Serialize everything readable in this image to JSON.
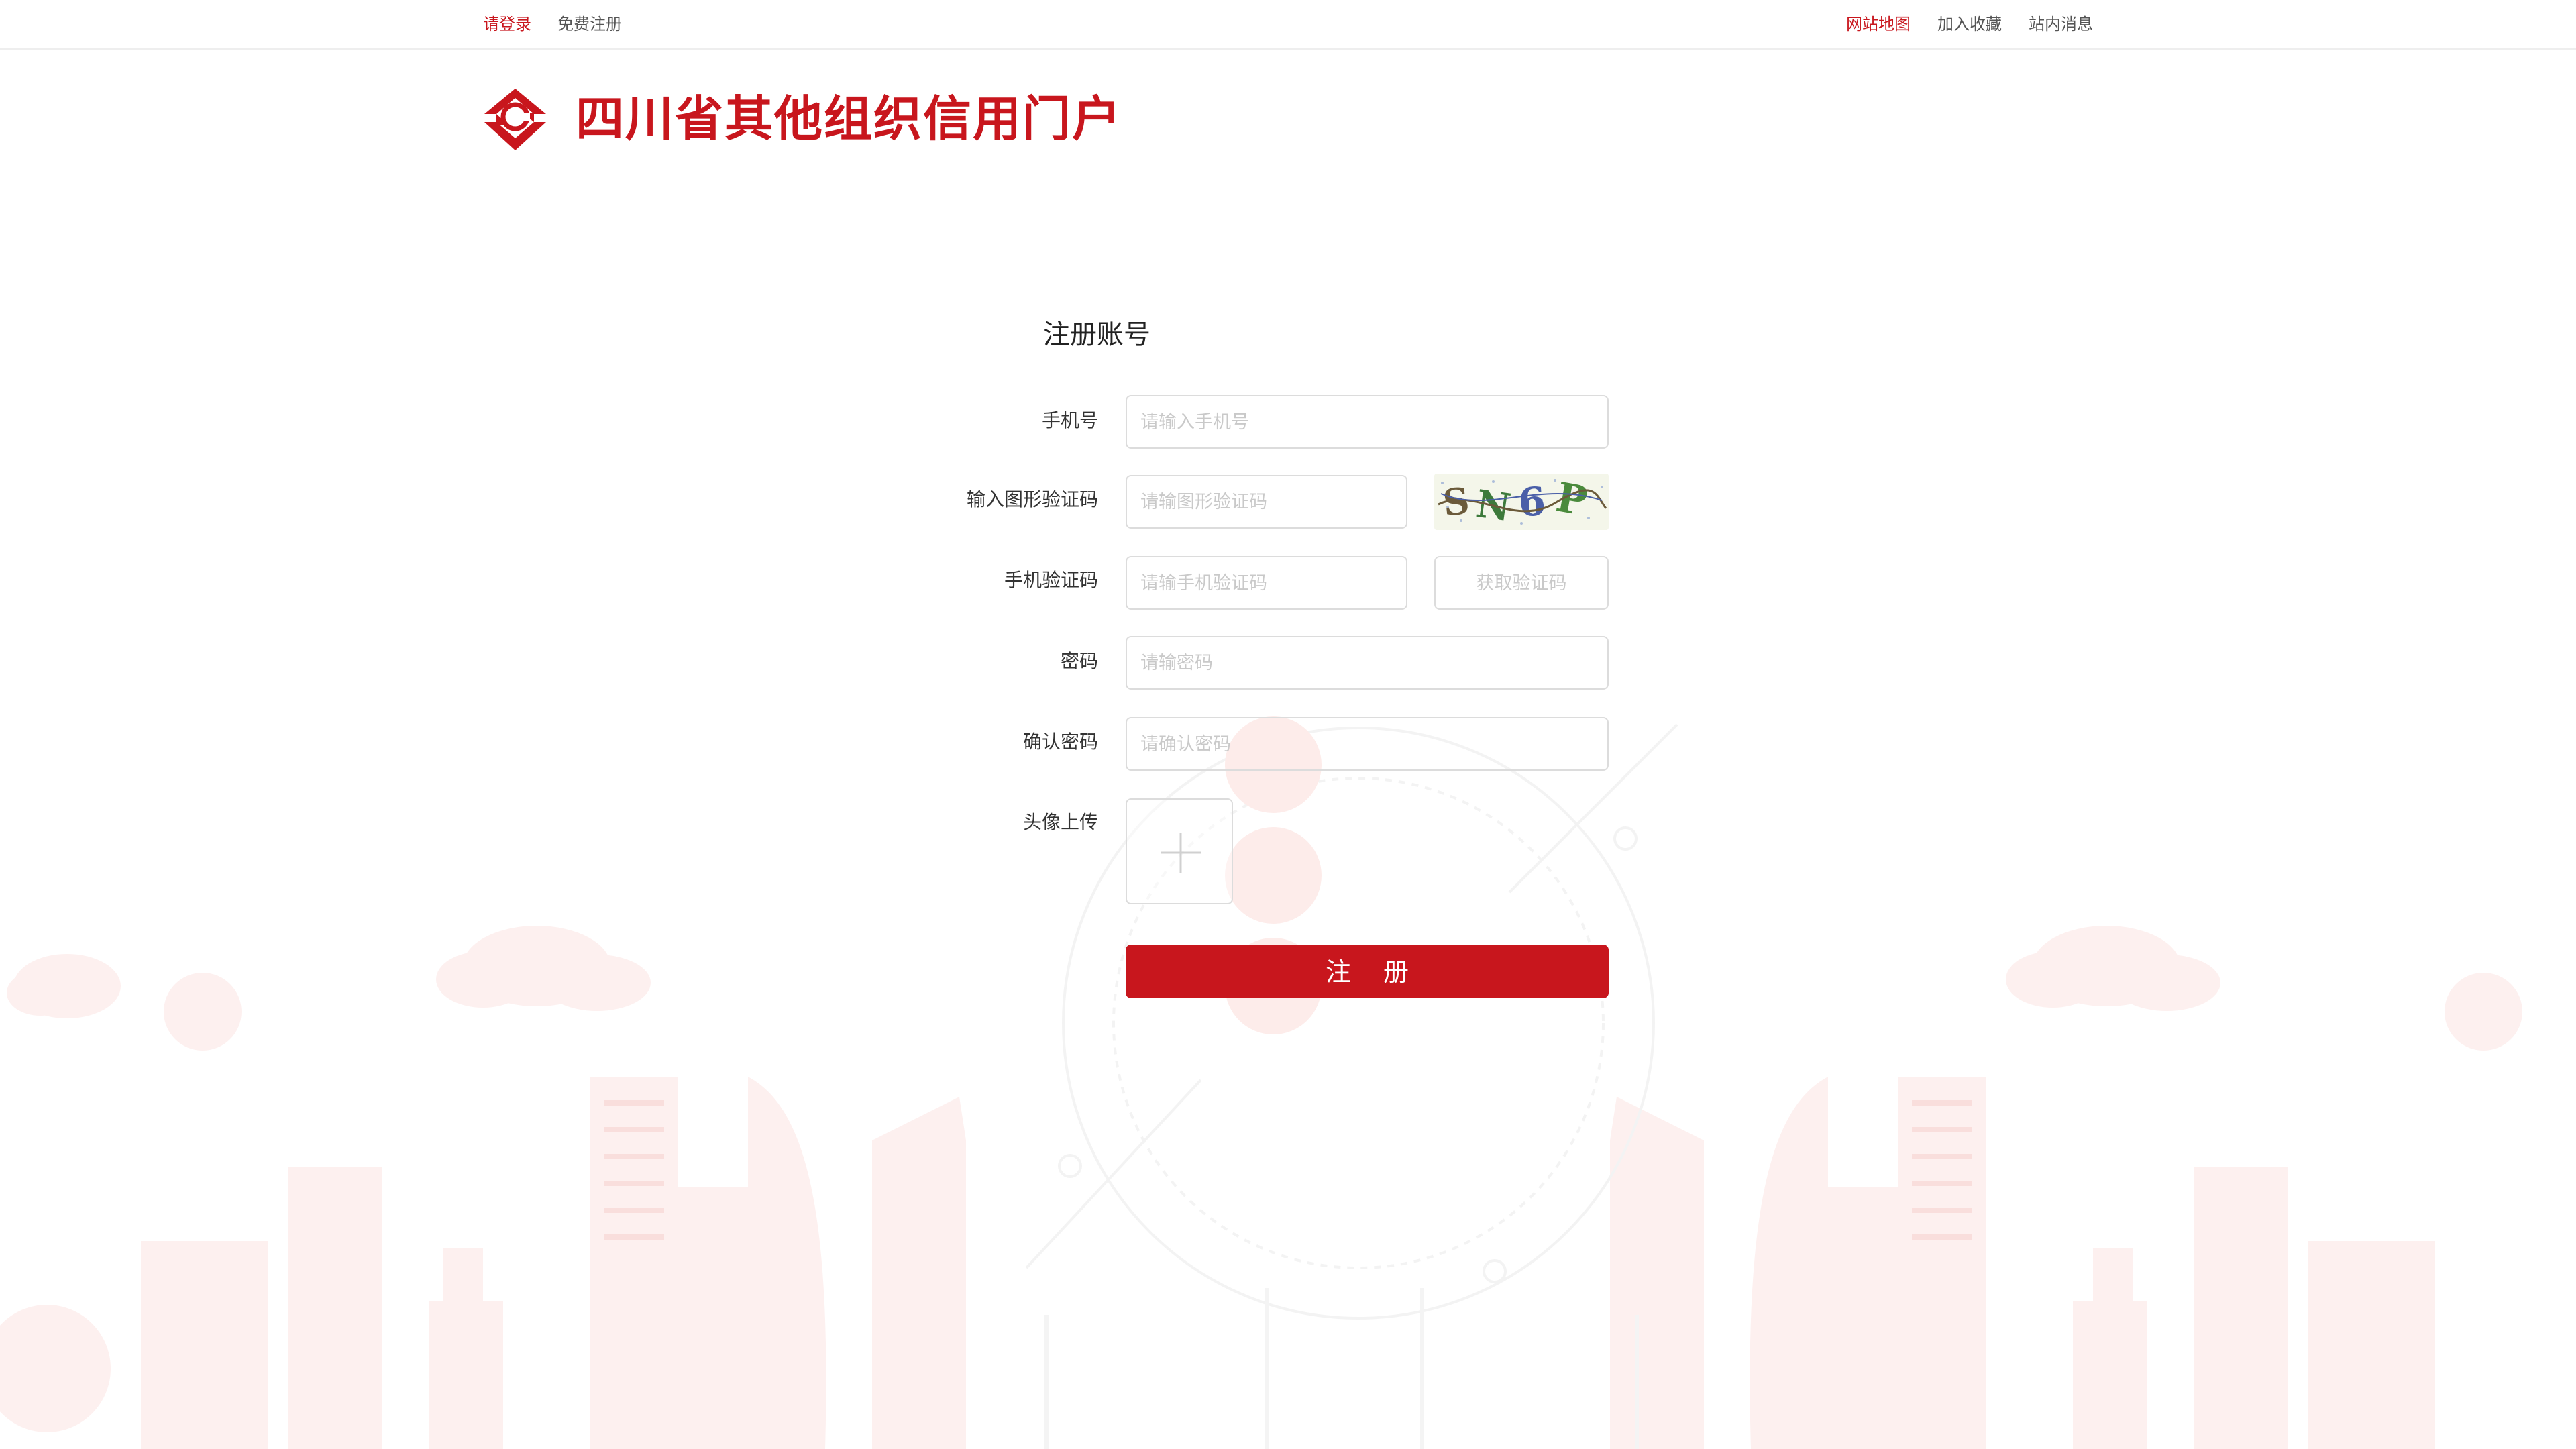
{
  "topbar": {
    "login": "请登录",
    "register": "免费注册",
    "sitemap": "网站地图",
    "favorite": "加入收藏",
    "messages": "站内消息"
  },
  "header": {
    "logo_icon": "credit-logo-icon",
    "title": "四川省其他组织信用门户"
  },
  "form": {
    "title": "注册账号",
    "phone": {
      "label": "手机号",
      "placeholder": "请输入手机号",
      "value": ""
    },
    "captcha": {
      "label": "输入图形验证码",
      "placeholder": "请输图形验证码",
      "value": "",
      "image_text": "SN6P"
    },
    "sms": {
      "label": "手机验证码",
      "placeholder": "请输手机验证码",
      "value": "",
      "button": "获取验证码"
    },
    "password": {
      "label": "密码",
      "placeholder": "请输密码",
      "value": ""
    },
    "confirm": {
      "label": "确认密码",
      "placeholder": "请确认密码",
      "value": ""
    },
    "avatar": {
      "label": "头像上传",
      "icon": "plus-icon"
    },
    "submit": "注 册"
  },
  "colors": {
    "brand": "#c8161d",
    "border": "#dcdcdc",
    "placeholder": "#c9c9c9",
    "background_art": "#fdeceb"
  }
}
